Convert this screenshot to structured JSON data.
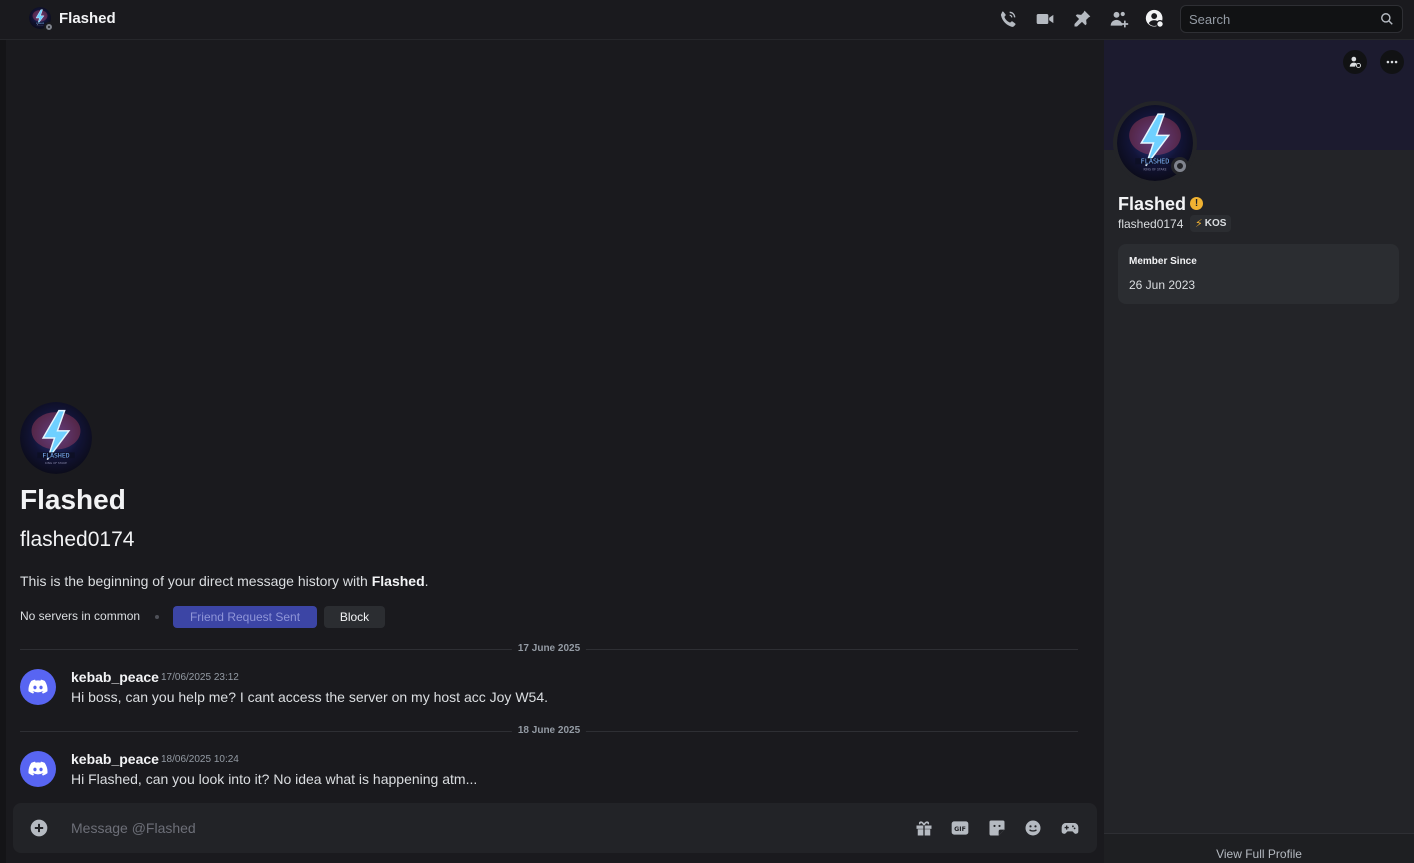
{
  "header": {
    "title": "Flashed",
    "icons": [
      "call-icon",
      "video-icon",
      "pin-icon",
      "add-friend-icon",
      "user-profile-icon"
    ],
    "search_placeholder": "Search"
  },
  "intro": {
    "display_name": "Flashed",
    "username": "flashed0174",
    "beginning_text": "This is the beginning of your direct message history with ",
    "beginning_name": "Flashed",
    "beginning_end": ".",
    "no_servers": "No servers in common",
    "friend_request_label": "Friend Request Sent",
    "block_label": "Block"
  },
  "messages": [
    {
      "date_divider": "17 June 2025",
      "author": "kebab_peace",
      "timestamp": "17/06/2025 23:12",
      "text": "Hi boss, can you help me? I cant access the server on my host acc Joy W54."
    },
    {
      "date_divider": "18 June 2025",
      "author": "kebab_peace",
      "timestamp": "18/06/2025 10:24",
      "text": "Hi Flashed, can you look into it? No idea what is happening atm..."
    }
  ],
  "composer": {
    "placeholder": "Message @Flashed",
    "icons": [
      "gift-icon",
      "gif-icon",
      "sticker-icon",
      "emoji-icon",
      "game-icon"
    ]
  },
  "profile": {
    "display_name": "Flashed",
    "warning_symbol": "!",
    "username": "flashed0174",
    "tag_icon": "⚡",
    "tag": "KOS",
    "member_since_label": "Member Since",
    "member_since": "26 Jun 2023",
    "view_full_profile": "View Full Profile"
  },
  "colors": {
    "background": "#1a1a1e",
    "panel": "#232428",
    "blurple": "#5865f2",
    "friend_button": "#3c45a5",
    "warning": "#f0b232"
  }
}
